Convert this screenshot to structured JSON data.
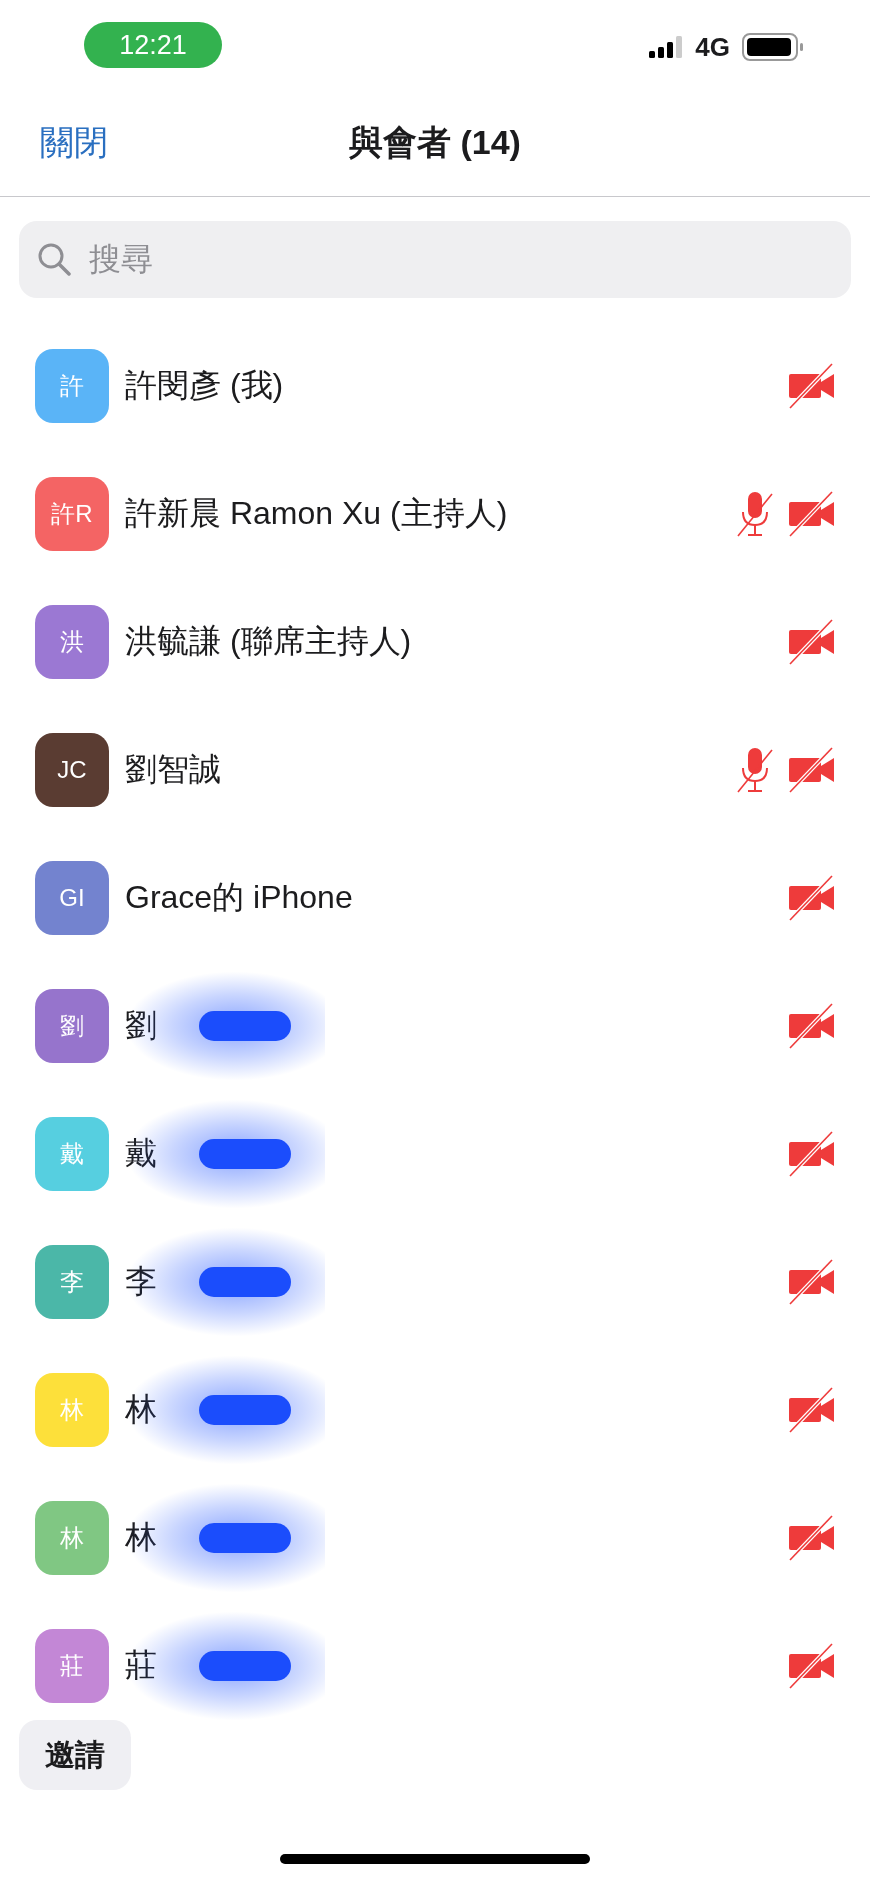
{
  "status_bar": {
    "time": "12:21",
    "network": "4G"
  },
  "nav": {
    "close": "關閉",
    "title": "與會者 (14)"
  },
  "search": {
    "placeholder": "搜尋"
  },
  "participants": [
    {
      "initials": "許",
      "color": "#5ab4f7",
      "name": "許閔彥 (我)",
      "mic_muted": false,
      "video_off": true,
      "redacted": false
    },
    {
      "initials": "許R",
      "color": "#f46464",
      "name": "許新晨 Ramon Xu (主持人)",
      "mic_muted": true,
      "video_off": true,
      "redacted": false
    },
    {
      "initials": "洪",
      "color": "#9b78d3",
      "name": "洪毓謙 (聯席主持人)",
      "mic_muted": false,
      "video_off": true,
      "redacted": false
    },
    {
      "initials": "JC",
      "color": "#5a3c32",
      "name": "劉智誠",
      "mic_muted": true,
      "video_off": true,
      "redacted": false
    },
    {
      "initials": "GI",
      "color": "#7383cf",
      "name": "Grace的 iPhone",
      "mic_muted": false,
      "video_off": true,
      "redacted": false
    },
    {
      "initials": "劉",
      "color": "#9674cc",
      "name": "劉",
      "mic_muted": false,
      "video_off": true,
      "redacted": true
    },
    {
      "initials": "戴",
      "color": "#56cfe0",
      "name": "戴",
      "mic_muted": false,
      "video_off": true,
      "redacted": true
    },
    {
      "initials": "李",
      "color": "#4bb7a8",
      "name": "李",
      "mic_muted": false,
      "video_off": true,
      "redacted": true
    },
    {
      "initials": "林",
      "color": "#fde03a",
      "name": "林",
      "mic_muted": false,
      "video_off": true,
      "redacted": true
    },
    {
      "initials": "林",
      "color": "#80c783",
      "name": "林",
      "mic_muted": false,
      "video_off": true,
      "redacted": true
    },
    {
      "initials": "莊",
      "color": "#c387d6",
      "name": "莊",
      "mic_muted": false,
      "video_off": true,
      "redacted": true
    }
  ],
  "invite_button": "邀請"
}
